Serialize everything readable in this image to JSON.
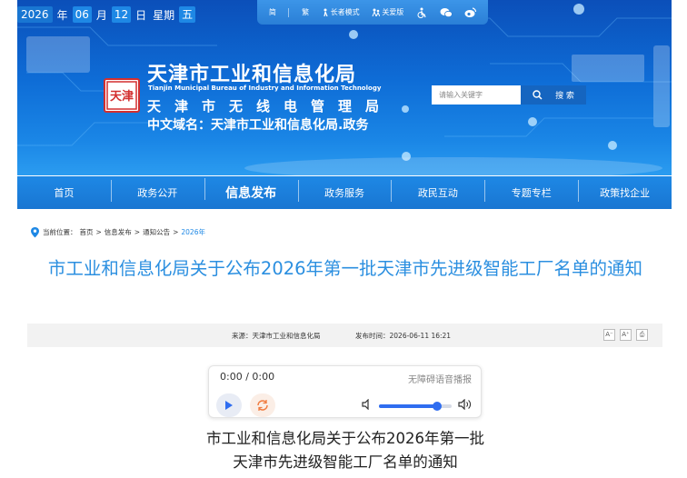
{
  "date": {
    "year": "2026",
    "year_unit": "年",
    "month": "06",
    "month_unit": "月",
    "day": "12",
    "day_unit": "日",
    "weekday_label": "星期",
    "weekday": "五"
  },
  "toolbar": {
    "simplified": "简",
    "traditional": "繁",
    "elder_mode": "长者模式",
    "care_edition": "关爱版"
  },
  "header": {
    "title": "天津市工业和信息化局",
    "title_en": "Tianjin Municipal Bureau of Industry and Information Technology",
    "subtitle": "天津市无线电管理局",
    "domain": "中文域名：天津市工业和信息化局.政务",
    "logo_text": "天津"
  },
  "search": {
    "placeholder": "请输入关键字",
    "button": "搜 索"
  },
  "nav": {
    "items": [
      "首页",
      "政务公开",
      "信息发布",
      "政务服务",
      "政民互动",
      "专题专栏",
      "政策找企业"
    ]
  },
  "breadcrumb": {
    "prefix": "当前位置：",
    "items": [
      "首页",
      "信息发布",
      "通知公告"
    ],
    "current": "2026年",
    "separator": ">"
  },
  "article": {
    "title": "市工业和信息化局关于公布2026年第一批天津市先进级智能工厂名单的通知",
    "source": "来源：天津市工业和信息化局",
    "publish_time": "发布时间：2026-06-11 16:21",
    "tools": [
      "A⁻",
      "A⁺",
      "⎙"
    ],
    "subtitle_line1": "市工业和信息化局关于公布2026年第一批",
    "subtitle_line2": "天津市先进级智能工厂名单的通知"
  },
  "player": {
    "time": "0:00 / 0:00",
    "accessible_label": "无障碍语音播报",
    "volume_level": 0.8
  },
  "colors": {
    "banner": "#0e6cd6",
    "nav": "#1e88e5",
    "title_blue": "#2b8fe0",
    "accent": "#2f6df0"
  }
}
